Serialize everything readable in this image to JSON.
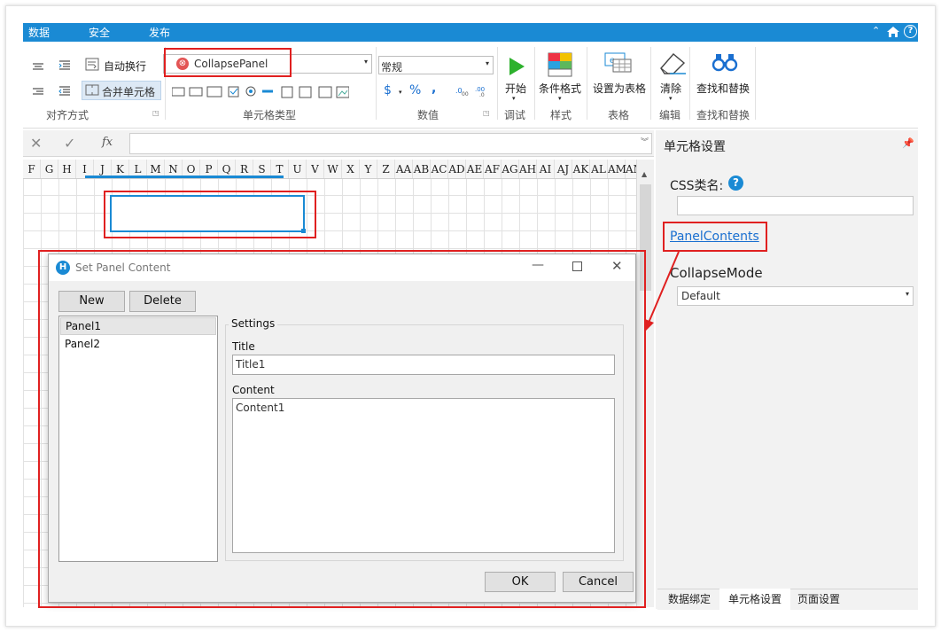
{
  "menu_tabs": [
    "数据",
    "安全",
    "发布"
  ],
  "ribbon": {
    "auto_wrap": "自动换行",
    "merge_cells": "合并单元格",
    "align_group": "对齐方式",
    "cell_type_value": "CollapsePanel",
    "cell_type_group": "单元格类型",
    "number_format": "常规",
    "currency": "$",
    "percent": "%",
    "comma": ",",
    "number_group": "数值",
    "start": "开始",
    "debug_group": "调试",
    "conditional": "条件格式",
    "style_group": "样式",
    "set_as_table": "设置为表格",
    "table_group": "表格",
    "clear": "清除",
    "edit_group": "编辑",
    "find_replace": "查找和替换",
    "find_group": "查找和替换"
  },
  "formula": {
    "cancel": "✕",
    "confirm": "✓",
    "fx": "fx"
  },
  "columns": [
    "F",
    "G",
    "H",
    "I",
    "J",
    "K",
    "L",
    "M",
    "N",
    "O",
    "P",
    "Q",
    "R",
    "S",
    "T",
    "U",
    "V",
    "W",
    "X",
    "Y",
    "Z",
    "AA",
    "AB",
    "AC",
    "AD",
    "AE",
    "AF",
    "AG",
    "AH",
    "AI",
    "AJ",
    "AK",
    "AL",
    "AM",
    "AN"
  ],
  "right_panel": {
    "title": "单元格设置",
    "css_label": "CSS类名:",
    "panel_contents": "PanelContents",
    "collapse_mode_label": "CollapseMode",
    "collapse_mode_value": "Default",
    "tabs": [
      "数据绑定",
      "单元格设置",
      "页面设置"
    ]
  },
  "dialog": {
    "title": "Set Panel Content",
    "new_button": "New",
    "delete_button": "Delete",
    "panels": [
      "Panel1",
      "Panel2"
    ],
    "settings_label": "Settings",
    "title_label": "Title",
    "title_value": "Title1",
    "content_label": "Content",
    "content_value": "Content1",
    "ok": "OK",
    "cancel": "Cancel"
  },
  "colors": {
    "accent": "#1a8ad4",
    "highlight": "#e02020",
    "link": "#1a6fd0"
  }
}
